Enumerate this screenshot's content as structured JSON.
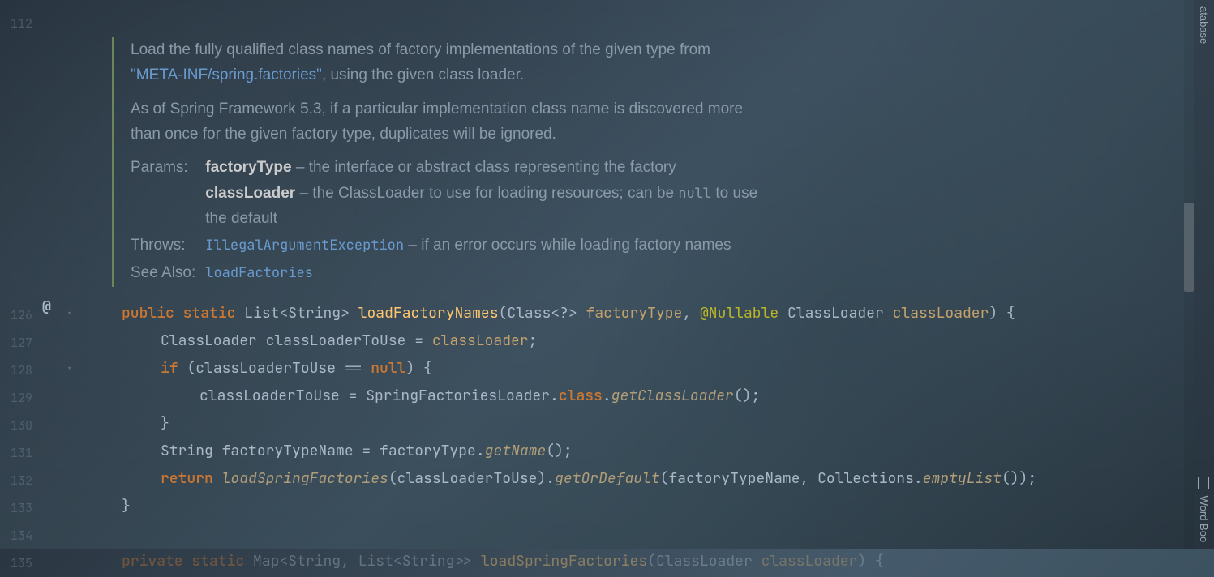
{
  "gutter_lines": [
    "112",
    "126",
    "127",
    "128",
    "129",
    "130",
    "131",
    "132",
    "133",
    "134",
    "135"
  ],
  "gutter_marker": "@",
  "doc": {
    "summary_a": "Load the fully qualified class names of factory implementations of the given type from ",
    "summary_link": "\"META-INF/spring.factories\"",
    "summary_b": ", using the given class loader.",
    "note": "As of Spring Framework 5.3, if a particular implementation class name is discovered more than once for the given factory type, duplicates will be ignored.",
    "params_label": "Params:",
    "params": {
      "factoryType": {
        "name": "factoryType",
        "desc": " – the interface or abstract class representing the factory"
      },
      "classLoader": {
        "name": "classLoader",
        "desc_a": " – the ClassLoader to use for loading resources; can be ",
        "null_word": "null",
        "desc_b": " to use the default"
      }
    },
    "throws_label": "Throws:",
    "throws": {
      "name": "IllegalArgumentException",
      "desc": " – if an error occurs while loading factory names"
    },
    "see_also_label": "See Also:",
    "see_also": "loadFactories"
  },
  "code": {
    "l126": {
      "public": "public",
      "static": "static",
      "list": "List",
      "lt": "<",
      "string": "String",
      "gt": ">",
      "method": "loadFactoryNames",
      "op": "(",
      "class": "Class",
      "wild": "<?>",
      "p1": "factoryType",
      "comma": ", ",
      "ann": "@Nullable",
      "cltype": "ClassLoader",
      "p2": "classLoader",
      "cp": ")",
      "ob": " {"
    },
    "l127": {
      "type": "ClassLoader",
      "var": "classLoaderToUse",
      "eq": " = ",
      "src": "classLoader",
      "semi": ";"
    },
    "l128": {
      "if": "if",
      "op": " (",
      "var": "classLoaderToUse",
      "eqeq": " == ",
      "null": "null",
      "cp": ")",
      "ob": " {"
    },
    "l129": {
      "var": "classLoaderToUse",
      "eq": " = ",
      "cls": "SpringFactoriesLoader",
      "dot1": ".",
      "classw": "class",
      "dot2": ".",
      "method": "getClassLoader",
      "call": "();"
    },
    "l130": {
      "cb": "}"
    },
    "l131": {
      "type": "String",
      "var": "factoryTypeName",
      "eq": " = ",
      "src": "factoryType",
      "dot": ".",
      "method": "getName",
      "call": "();"
    },
    "l132": {
      "return": "return",
      "m1": "loadSpringFactories",
      "op": "(",
      "a1": "classLoaderToUse",
      "cp1": ")",
      "dot1": ".",
      "m2": "getOrDefault",
      "op2": "(",
      "a2": "factoryTypeName",
      "comma": ", ",
      "coll": "Collections",
      "dot2": ".",
      "m3": "emptyList",
      "call3": "()",
      "cp2": ");"
    },
    "l133": {
      "cb": "}"
    },
    "l135": {
      "private": "private",
      "static": "static",
      "map": "Map",
      "lt": "<",
      "string1": "String",
      "comma": ", ",
      "list": "List",
      "lt2": "<",
      "string2": "String",
      "gt2": ">",
      "gt": ">",
      "method": "loadSpringFactories",
      "op": "(",
      "cltype": "ClassLoader",
      "p1": "classLoader",
      "cp": ")",
      "ob": " {"
    }
  },
  "right_panel": {
    "database": "atabase",
    "wordbook": "Word Boo"
  }
}
